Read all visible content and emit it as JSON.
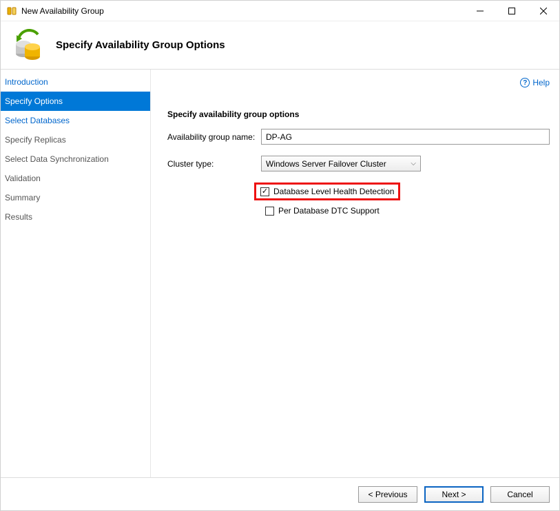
{
  "window": {
    "title": "New Availability Group"
  },
  "header": {
    "title": "Specify Availability Group Options"
  },
  "help": {
    "label": "Help"
  },
  "sidebar": {
    "items": [
      {
        "label": "Introduction",
        "link": true,
        "active": false
      },
      {
        "label": "Specify Options",
        "link": false,
        "active": true
      },
      {
        "label": "Select Databases",
        "link": true,
        "active": false
      },
      {
        "label": "Specify Replicas",
        "link": false,
        "active": false
      },
      {
        "label": "Select Data Synchronization",
        "link": false,
        "active": false
      },
      {
        "label": "Validation",
        "link": false,
        "active": false
      },
      {
        "label": "Summary",
        "link": false,
        "active": false
      },
      {
        "label": "Results",
        "link": false,
        "active": false
      }
    ]
  },
  "form": {
    "section_title": "Specify availability group options",
    "name_label": "Availability group name:",
    "name_value": "DP-AG",
    "cluster_label": "Cluster type:",
    "cluster_value": "Windows Server Failover Cluster",
    "db_health_label": "Database Level Health Detection",
    "db_health_checked": true,
    "dtc_label": "Per Database DTC Support",
    "dtc_checked": false
  },
  "footer": {
    "previous": "< Previous",
    "next": "Next >",
    "cancel": "Cancel"
  }
}
